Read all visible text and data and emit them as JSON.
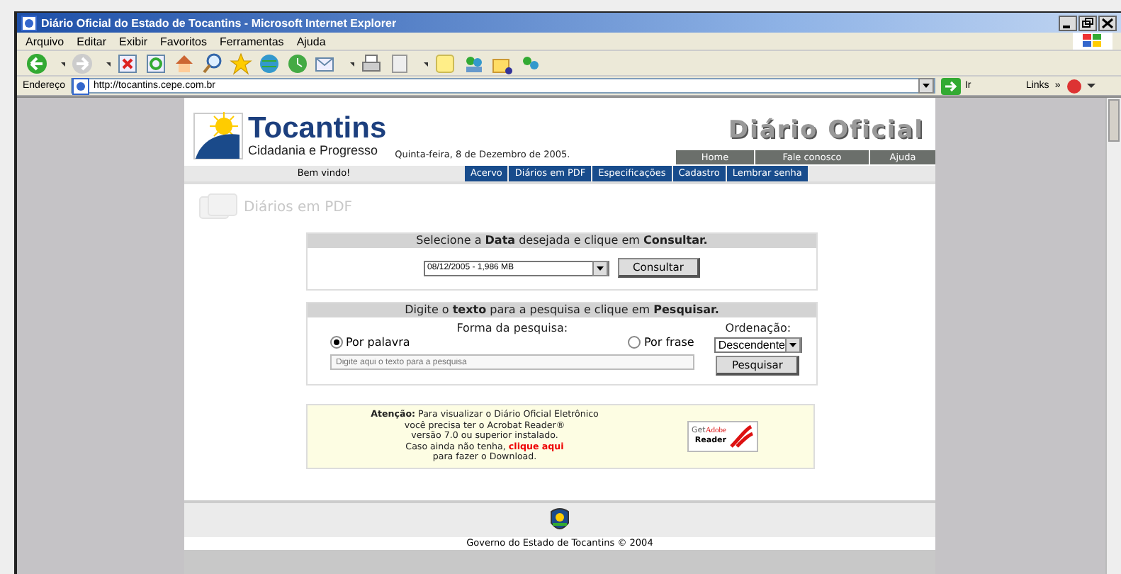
{
  "window": {
    "title": "Diário Oficial do Estado de Tocantins - Microsoft Internet Explorer"
  },
  "menu": [
    "Arquivo",
    "Editar",
    "Exibir",
    "Favoritos",
    "Ferramentas",
    "Ajuda"
  ],
  "address": {
    "label": "Endereço",
    "url": "http://tocantins.cepe.com.br",
    "go": "Ir",
    "links": "Links",
    "more": "»"
  },
  "header": {
    "brand": "Tocantins",
    "slogan": "Cidadania e Progresso",
    "title": "Diário Oficial",
    "date": "Quinta-feira, 8 de Dezembro de 2005.",
    "nav": [
      "Home",
      "Fale conosco",
      "Ajuda"
    ]
  },
  "welcome": "Bem vindo!",
  "tabs": [
    {
      "label": "Acervo",
      "selected": false
    },
    {
      "label": "Diários em PDF",
      "selected": false
    },
    {
      "label": "Especificações",
      "selected": false
    },
    {
      "label": "Cadastro",
      "selected": false
    },
    {
      "label": "Lembrar senha",
      "selected": false
    }
  ],
  "section_title": "Diários em PDF",
  "date_box": {
    "heading": "Selecione a **Data** desejada e clique em **Consultar.**",
    "select": "08/12/2005 - 1,986 MB",
    "button": "Consultar"
  },
  "search_box": {
    "heading": "Digite o **texto** para a pesquisa e clique em **Pesquisar.**",
    "mode_label": "Forma da pesquisa:",
    "modes": [
      {
        "label": "Por palavra",
        "selected": true
      },
      {
        "label": "Por frase",
        "selected": false
      }
    ],
    "order_label": "Ordenação:",
    "order": "Descendente",
    "placeholder": "Digite aqui o texto para a pesquisa",
    "button": "Pesquisar"
  },
  "notice": {
    "lines": [
      "**Atenção:** Para visualizar o Diário Oficial Eletrônico",
      "você precisa ter o Acrobat Reader®",
      "versão 7.0 ou superior instalado.",
      "Caso ainda não tenha,"
    ],
    "link": "clique aqui",
    "after": "para fazer o Download.",
    "badge": {
      "small": "Get",
      "brand": "Adobe",
      "product": "Reader"
    }
  },
  "footer": "Governo do Estado de Tocantins © 2004"
}
